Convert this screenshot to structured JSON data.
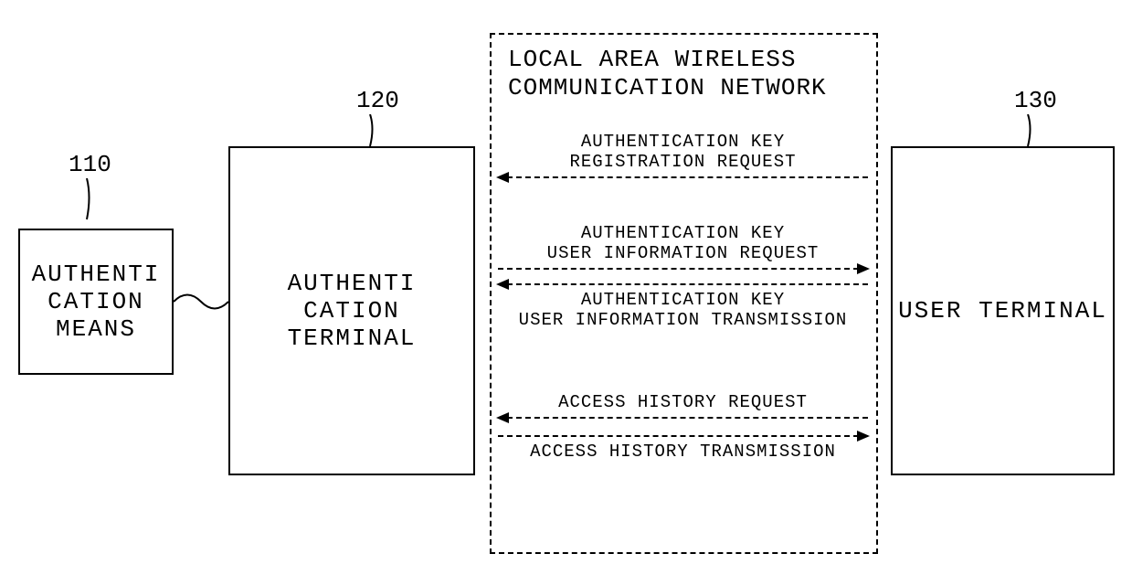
{
  "refs": {
    "auth_means": "110",
    "auth_terminal": "120",
    "user_terminal": "130"
  },
  "boxes": {
    "auth_means": "AUTHENTI\nCATION\nMEANS",
    "auth_terminal": "AUTHENTI\nCATION\nTERMINAL",
    "user_terminal": "USER TERMINAL"
  },
  "network_title": "LOCAL AREA WIRELESS\nCOMMUNICATION NETWORK",
  "messages": {
    "reg_request": "AUTHENTICATION KEY\nREGISTRATION REQUEST",
    "info_request": "AUTHENTICATION KEY\nUSER INFORMATION REQUEST",
    "info_transmission": "AUTHENTICATION KEY\nUSER INFORMATION TRANSMISSION",
    "history_request": "ACCESS HISTORY REQUEST",
    "history_transmission": "ACCESS HISTORY TRANSMISSION"
  }
}
